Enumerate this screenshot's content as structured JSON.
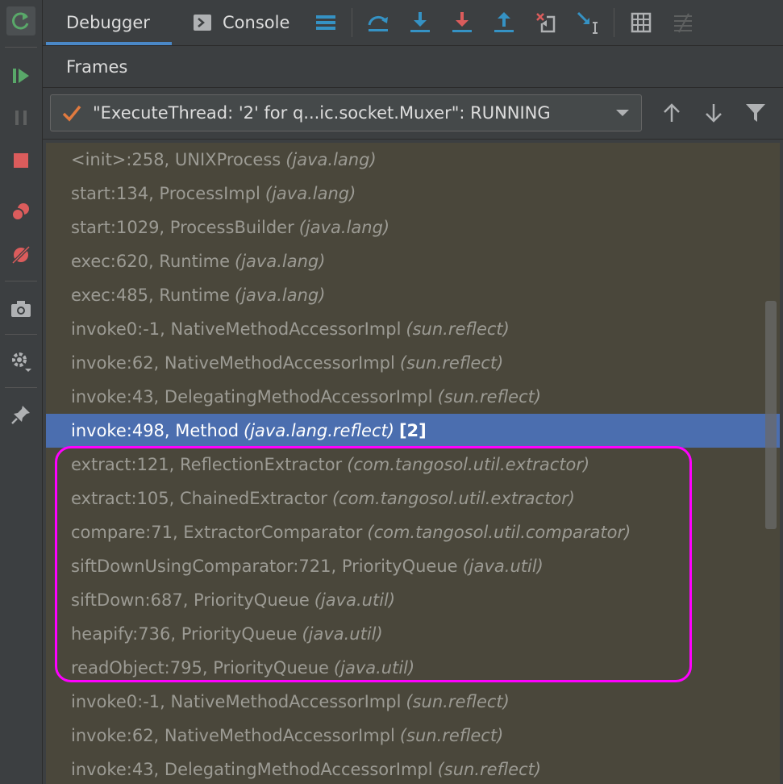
{
  "tabs": [
    {
      "label": "Debugger"
    },
    {
      "label": "Console"
    }
  ],
  "frames_header": {
    "label": "Frames"
  },
  "thread": {
    "label": "\"ExecuteThread: '2' for q...ic.socket.Muxer\": RUNNING"
  },
  "frames": [
    {
      "method": "<init>:258, UNIXProcess",
      "package": "(java.lang)"
    },
    {
      "method": "start:134, ProcessImpl",
      "package": "(java.lang)"
    },
    {
      "method": "start:1029, ProcessBuilder",
      "package": "(java.lang)"
    },
    {
      "method": "exec:620, Runtime",
      "package": "(java.lang)"
    },
    {
      "method": "exec:485, Runtime",
      "package": "(java.lang)"
    },
    {
      "method": "invoke0:-1, NativeMethodAccessorImpl",
      "package": "(sun.reflect)"
    },
    {
      "method": "invoke:62, NativeMethodAccessorImpl",
      "package": "(sun.reflect)"
    },
    {
      "method": "invoke:43, DelegatingMethodAccessorImpl",
      "package": "(sun.reflect)"
    },
    {
      "method": "invoke:498, Method",
      "package": "(java.lang.reflect)",
      "badge": "[2]",
      "selected": true
    },
    {
      "method": "extract:121, ReflectionExtractor",
      "package": "(com.tangosol.util.extractor)"
    },
    {
      "method": "extract:105, ChainedExtractor",
      "package": "(com.tangosol.util.extractor)"
    },
    {
      "method": "compare:71, ExtractorComparator",
      "package": "(com.tangosol.util.comparator)"
    },
    {
      "method": "siftDownUsingComparator:721, PriorityQueue",
      "package": "(java.util)"
    },
    {
      "method": "siftDown:687, PriorityQueue",
      "package": "(java.util)"
    },
    {
      "method": "heapify:736, PriorityQueue",
      "package": "(java.util)"
    },
    {
      "method": "readObject:795, PriorityQueue",
      "package": "(java.util)"
    },
    {
      "method": "invoke0:-1, NativeMethodAccessorImpl",
      "package": "(sun.reflect)"
    },
    {
      "method": "invoke:62, NativeMethodAccessorImpl",
      "package": "(sun.reflect)"
    },
    {
      "method": "invoke:43, DelegatingMethodAccessorImpl",
      "package": "(sun.reflect)"
    }
  ],
  "colors": {
    "highlight": "#ff00ff",
    "selected_row": "#4b6eaf",
    "accent": "#4a88c7"
  }
}
